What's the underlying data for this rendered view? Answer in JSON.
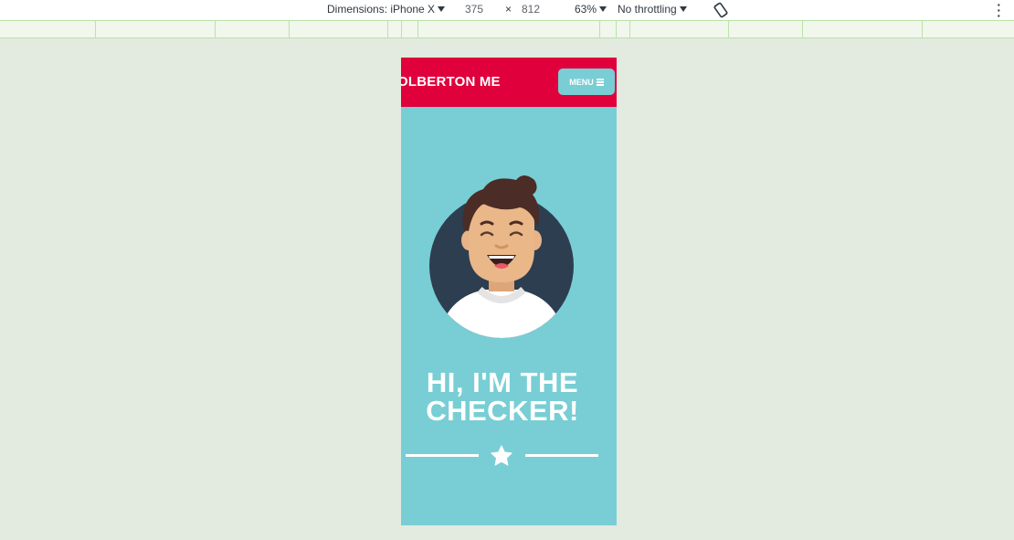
{
  "devtools": {
    "device_label": "Dimensions: iPhone X",
    "width": "375",
    "times": "×",
    "height": "812",
    "zoom": "63%",
    "throttling": "No throttling",
    "more_icon": "kebab-menu-icon",
    "rotate_icon": "rotate-device-icon"
  },
  "site": {
    "brand": "OLBERTON ME",
    "menu_label": "MENU",
    "menu_icon": "hamburger-icon",
    "hero_title_line1": "HI, I'M THE",
    "hero_title_line2": "CHECKER!",
    "divider_icon": "star-icon"
  },
  "colors": {
    "navbar": "#e0003b",
    "hero_bg": "#78ced4",
    "avatar_circle": "#2d3e50"
  }
}
